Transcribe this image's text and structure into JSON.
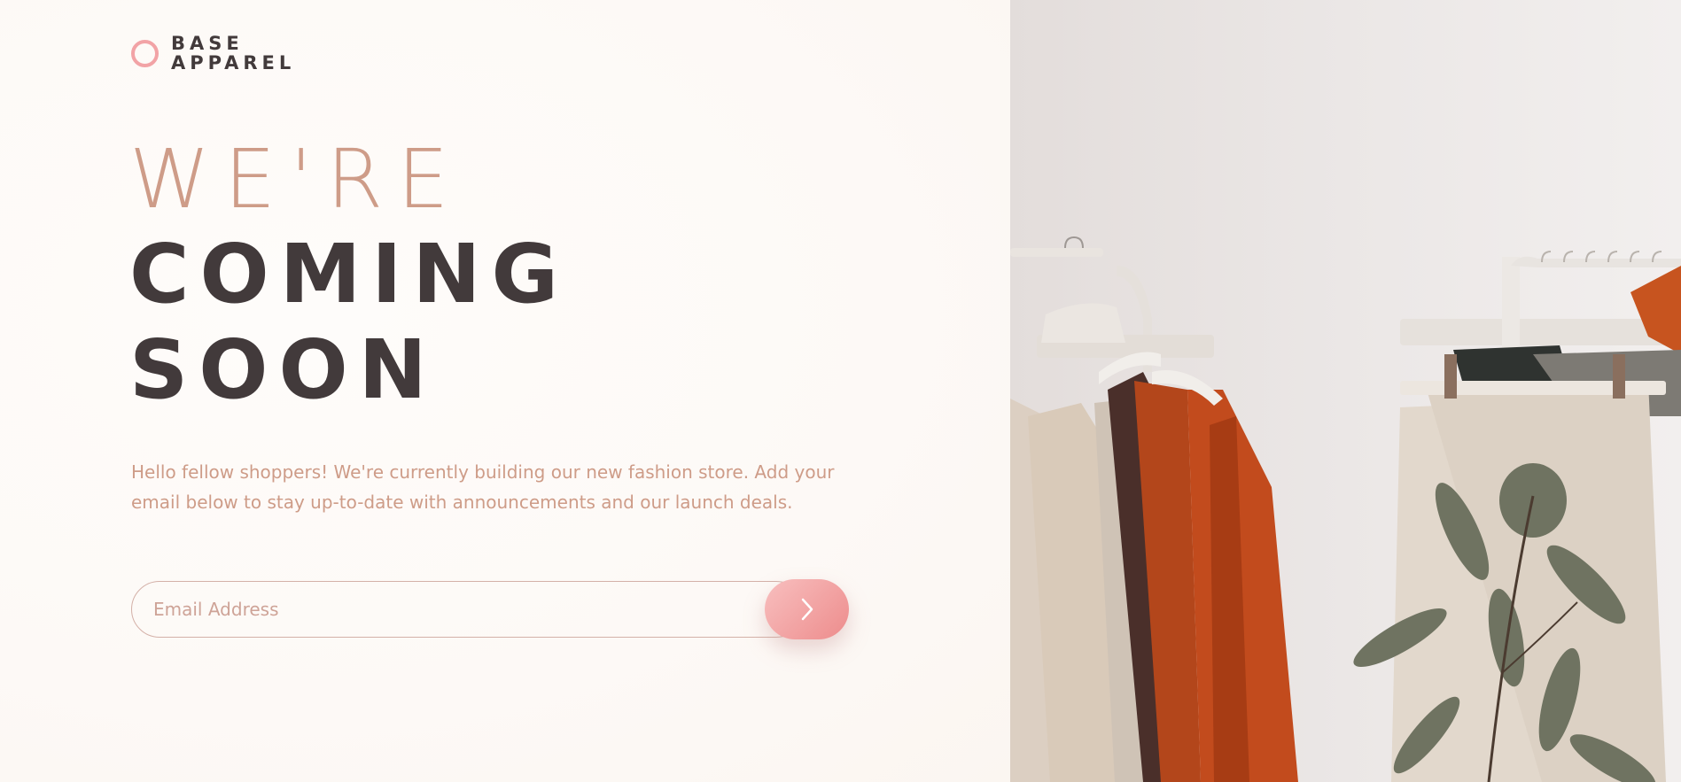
{
  "brand": {
    "line1": "BASE",
    "line2": "APPAREL",
    "accent_color": "#f2a3a6"
  },
  "hero": {
    "title_light": "WE'RE",
    "title_bold_line1": "COMING",
    "title_bold_line2": "SOON",
    "description": "Hello fellow shoppers! We're currently building our new fashion store. Add your email below to stay up-to-date with announcements and our launch deals."
  },
  "form": {
    "email_placeholder": "Email Address",
    "email_value": "",
    "submit_icon": "arrow-right-icon"
  },
  "colors": {
    "text_dark": "#423a3b",
    "text_accent": "#ce9c88",
    "button_gradient_start": "#f8bfbf",
    "button_gradient_end": "#ed8c8c"
  },
  "hero_image": {
    "subject": "clothing-rack-with-plant-photo"
  }
}
